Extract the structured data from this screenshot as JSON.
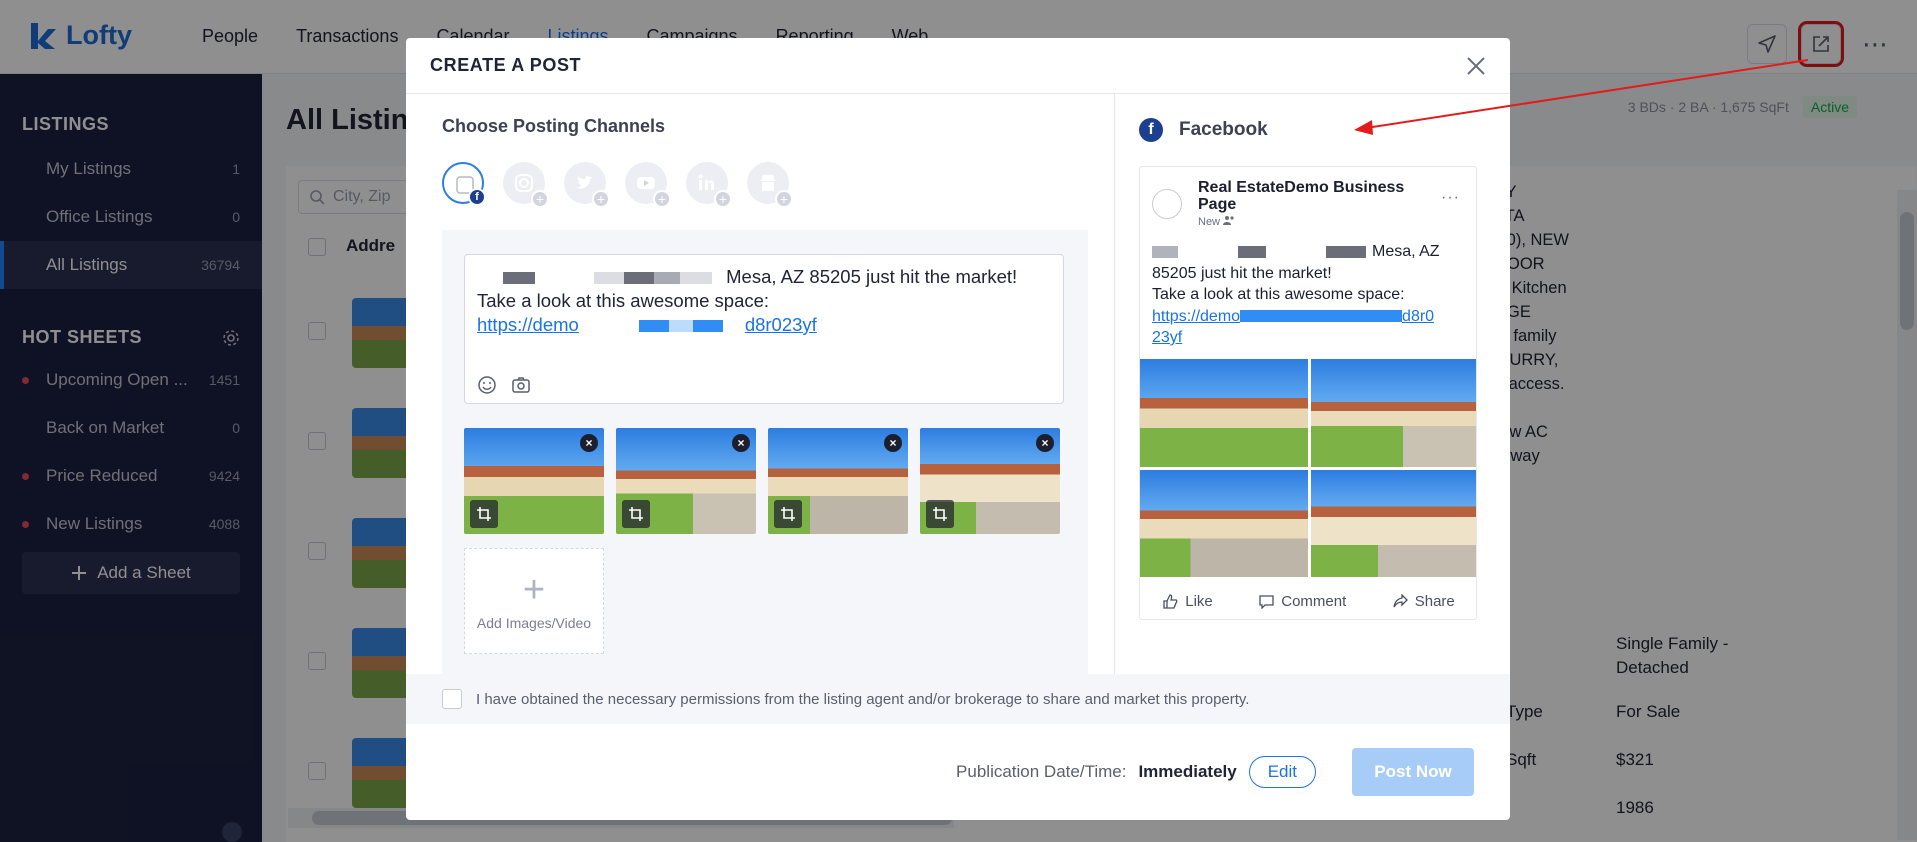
{
  "app": {
    "logo_text": "Lofty",
    "nav": [
      "People",
      "Transactions",
      "Calendar",
      "Listings",
      "Campaigns",
      "Reporting",
      "Web"
    ],
    "nav_active_index": 3,
    "more_glyph": "⋯"
  },
  "sidebar": {
    "listings_heading": "LISTINGS",
    "items": [
      {
        "label": "My Listings",
        "count": "1"
      },
      {
        "label": "Office Listings",
        "count": "0"
      },
      {
        "label": "All Listings",
        "count": "36794"
      }
    ],
    "hot_sheets_heading": "HOT SHEETS",
    "hot_sheets": [
      {
        "label": "Upcoming Open ...",
        "count": "1451"
      },
      {
        "label": "Back on Market",
        "count": "0"
      },
      {
        "label": "Price Reduced",
        "count": "9424"
      },
      {
        "label": "New Listings",
        "count": "4088"
      }
    ],
    "add_sheet_label": "Add a Sheet"
  },
  "main": {
    "page_title": "All Listin",
    "search_placeholder": "City, Zip",
    "address_header": "Addre",
    "summary": "3 BDs · 2 BA · 1,675 SqFt",
    "status": "Active",
    "description": "DY...3 BED/2 BATH...SINGLE STORY\n Located in the highly sought-after ALTA\ng NEW ROOF (2021), NEW AC (2020), NEW\nep into the BRIGHTLY LIT, OPEN FLOOR\naring VAULTED CELINGS. Spacious Kitchen\nNTER TOPS. Step outside to the HUGE\nD COVERED PATIO AREA...ideal for family\nar garage w/ storage & workspace. HURRY,\nschools, shopping and easy freeway access. It\nates including: -New Roof (2021) -New AC\nl Deck Renovation (2023) -New Entryway\nst!!",
    "props": [
      {
        "key": "",
        "value": "Single Family - Detached"
      },
      {
        "key": "Type",
        "value": "For Sale"
      },
      {
        "key": "Sqft",
        "value": "$321"
      },
      {
        "key": "",
        "value": "1986"
      }
    ]
  },
  "modal": {
    "title": "CREATE A POST",
    "choose_channels": "Choose Posting Channels",
    "fb_badge": "f",
    "post_text_line1": "Mesa, AZ 85205 just hit the market!",
    "post_text_line2": "Take a look at this awesome space:",
    "post_link_start": "https://demo",
    "post_link_end": "d8r023yf",
    "add_media_label": "Add Images/Video",
    "add_media_plus": "+",
    "remove_glyph": "×",
    "preview": {
      "network": "Facebook",
      "network_glyph": "f",
      "page_name": "Real EstateDemo Business Page",
      "sub": "New",
      "dots": "···",
      "text_line1a": "Mesa, AZ",
      "text_line1b": "85205 just hit the market!",
      "text_line2": "Take a look at this awesome space:",
      "link_start": "https://demo",
      "link_mid": "d8r0",
      "link_end": "23yf",
      "like": "Like",
      "comment": "Comment",
      "share": "Share"
    },
    "permission_text": "I have obtained the necessary permissions from the listing agent and/or brokerage to share and market this property.",
    "publication_label": "Publication Date/Time:",
    "publication_value": "Immediately",
    "edit_label": "Edit",
    "post_now_label": "Post Now"
  },
  "colors": {
    "accent": "#1a73e8",
    "sidebar_bg": "#1c2140",
    "facebook": "#1d3f8f",
    "annotation": "#e21b1b"
  }
}
